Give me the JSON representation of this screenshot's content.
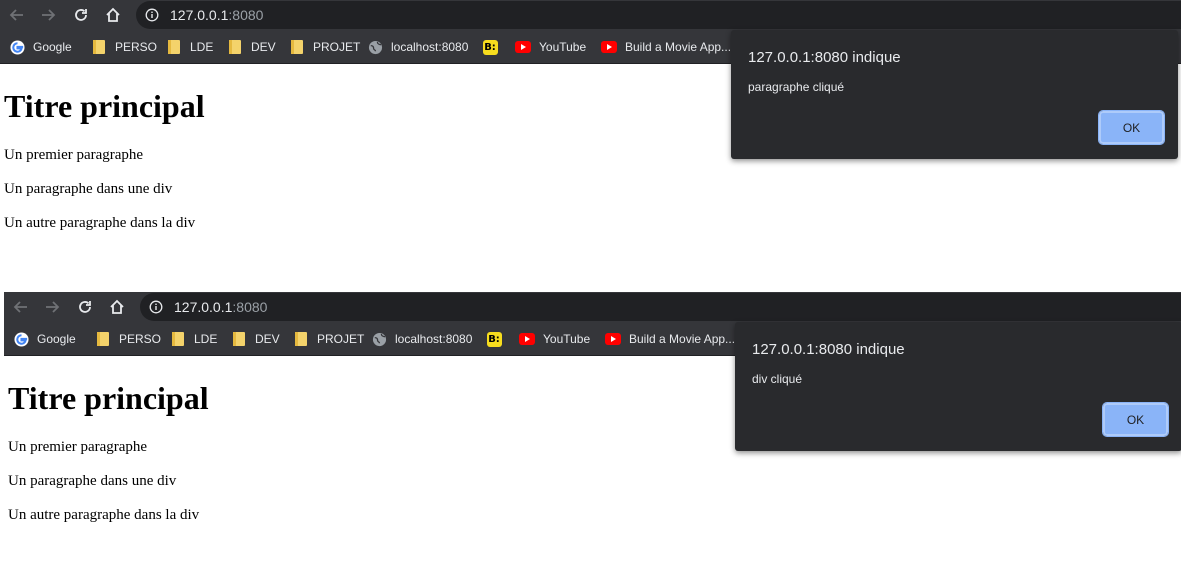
{
  "screens": [
    {
      "browser": {
        "url_host": "127.0.0.1",
        "url_port": ":8080"
      },
      "bookmarks": [
        {
          "label": "Google",
          "icon": "google-icon"
        },
        {
          "label": "PERSO",
          "icon": "folder-icon"
        },
        {
          "label": "LDE",
          "icon": "folder-icon"
        },
        {
          "label": "DEV",
          "icon": "folder-icon"
        },
        {
          "label": "PROJET",
          "icon": "folder-icon"
        },
        {
          "label": "localhost:8080",
          "icon": "globe-icon"
        },
        {
          "label": "",
          "icon": "b-icon",
          "glyph": "B:"
        },
        {
          "label": "YouTube",
          "icon": "youtube-icon"
        },
        {
          "label": "Build a Movie App...",
          "icon": "youtube-icon"
        }
      ],
      "page": {
        "heading": "Titre principal",
        "paragraphs": [
          "Un premier paragraphe",
          "Un paragraphe dans une div",
          "Un autre paragraphe dans la div"
        ]
      },
      "alert": {
        "title": "127.0.0.1:8080 indique",
        "message": "paragraphe cliqué",
        "ok_label": "OK"
      }
    },
    {
      "browser": {
        "url_host": "127.0.0.1",
        "url_port": ":8080"
      },
      "bookmarks": [
        {
          "label": "Google",
          "icon": "google-icon"
        },
        {
          "label": "PERSO",
          "icon": "folder-icon"
        },
        {
          "label": "LDE",
          "icon": "folder-icon"
        },
        {
          "label": "DEV",
          "icon": "folder-icon"
        },
        {
          "label": "PROJET",
          "icon": "folder-icon"
        },
        {
          "label": "localhost:8080",
          "icon": "globe-icon"
        },
        {
          "label": "",
          "icon": "b-icon",
          "glyph": "B:"
        },
        {
          "label": "YouTube",
          "icon": "youtube-icon"
        },
        {
          "label": "Build a Movie App...",
          "icon": "youtube-icon"
        }
      ],
      "page": {
        "heading": "Titre principal",
        "paragraphs": [
          "Un premier paragraphe",
          "Un paragraphe dans une div",
          "Un autre paragraphe dans la div"
        ]
      },
      "alert": {
        "title": "127.0.0.1:8080 indique",
        "message": "div cliqué",
        "ok_label": "OK"
      }
    }
  ],
  "colors": {
    "toolbar_bg": "#35363a",
    "omnibox_bg": "#202124",
    "dialog_bg": "#292a2d",
    "ok_button": "#8ab4f8",
    "page_bg": "#ffffff"
  }
}
